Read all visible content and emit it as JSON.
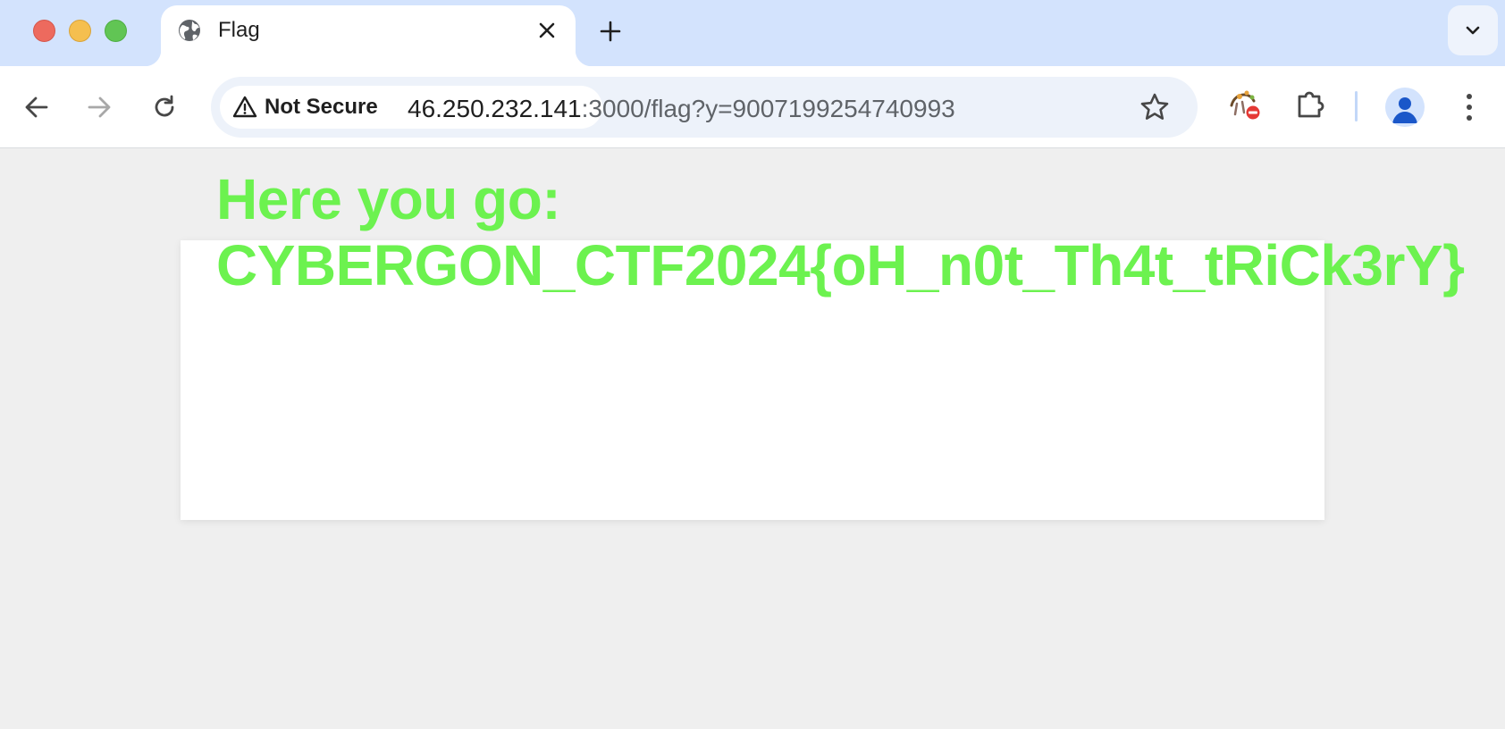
{
  "window": {
    "controls": [
      "close",
      "minimize",
      "maximize"
    ]
  },
  "tab": {
    "title": "Flag",
    "favicon": "globe-icon"
  },
  "toolbar": {
    "security_label": "Not Secure",
    "url_host": "46.250.232.141",
    "url_rest": ":3000/flag?y=9007199254740993"
  },
  "page": {
    "heading_line1": "Here you go:",
    "heading_line2": "CYBERGON_CTF2024{oH_n0t_Th4t_tRiCk3rY}",
    "text_color": "#6cf24f"
  }
}
